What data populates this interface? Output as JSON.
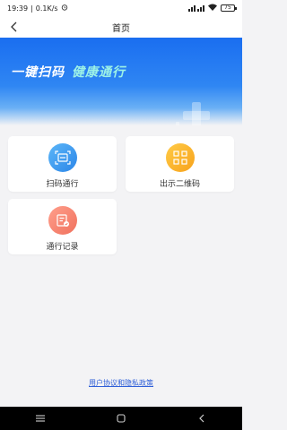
{
  "status_bar": {
    "time": "19:39",
    "separator": "|",
    "speed": "0.1K/s",
    "battery": "75"
  },
  "header": {
    "title": "首页"
  },
  "banner": {
    "text_main": "一键扫码",
    "text_highlight": "健康通行"
  },
  "actions": [
    {
      "label": "扫码通行",
      "icon": "scan-icon",
      "color": "#3a9af0"
    },
    {
      "label": "出示二维码",
      "icon": "qr-code-icon",
      "color": "#f9b22a"
    },
    {
      "label": "通行记录",
      "icon": "record-icon",
      "color": "#f58471"
    }
  ],
  "footer": {
    "policy_link": "用户协议和隐私政策"
  }
}
